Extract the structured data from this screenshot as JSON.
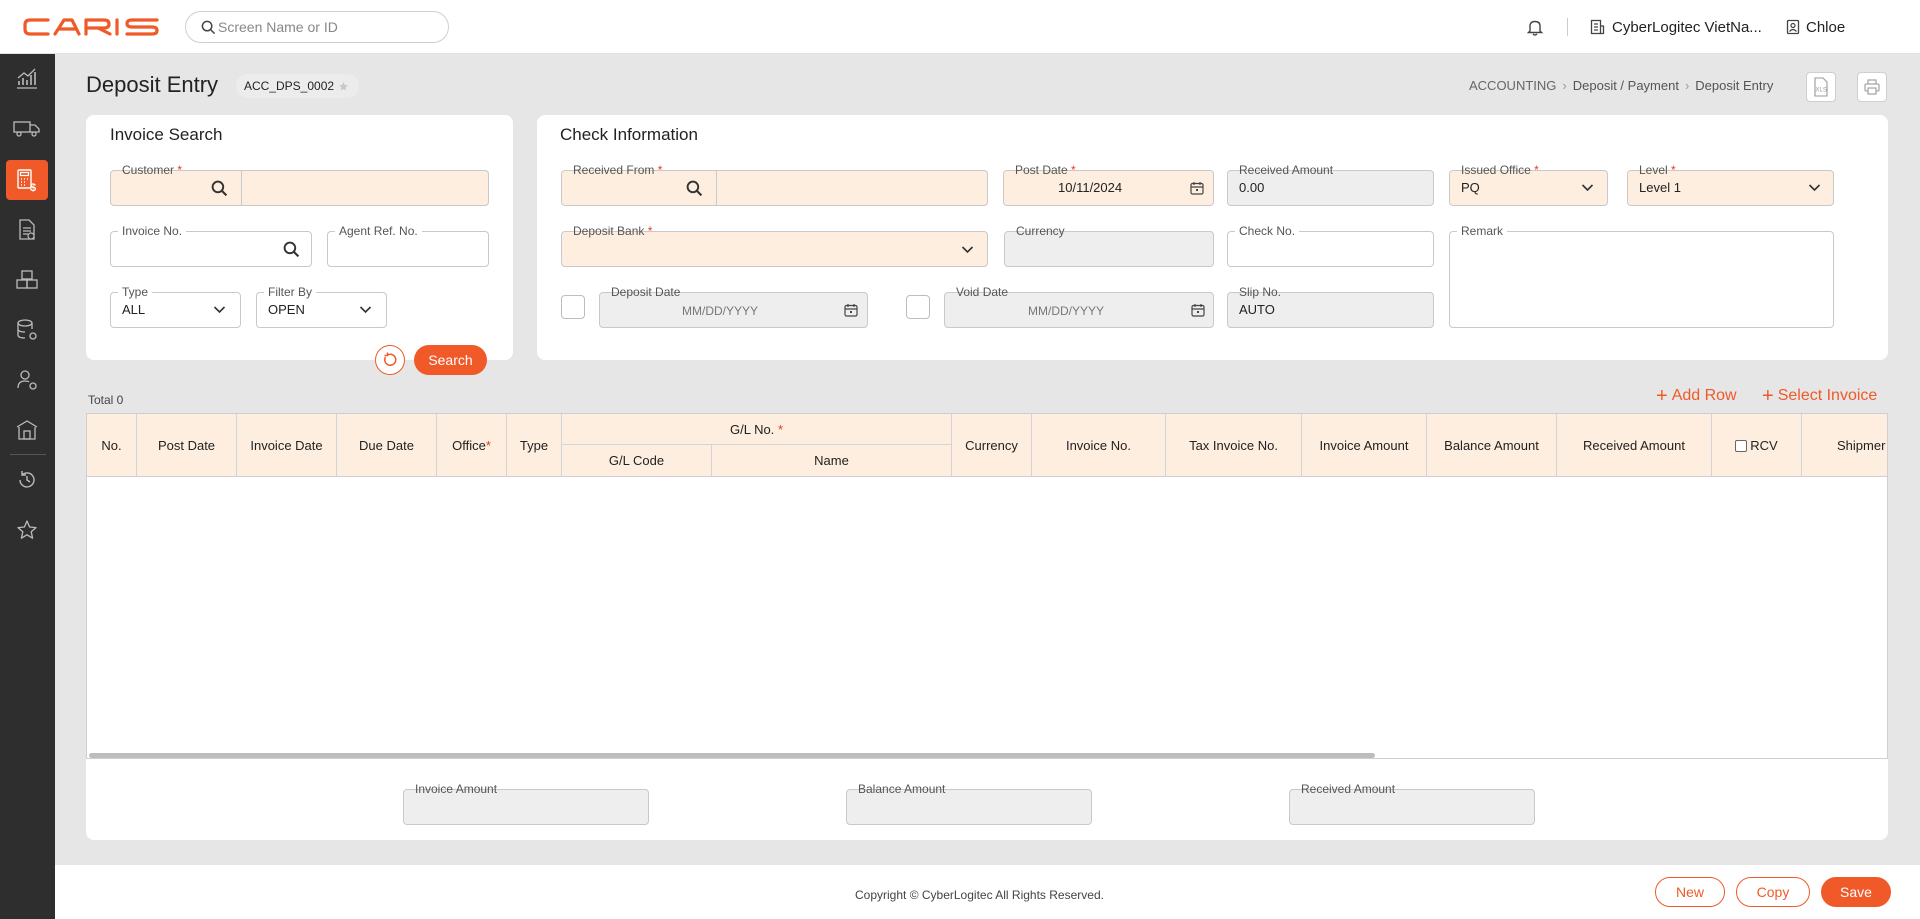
{
  "header": {
    "logo_text": "CARIS",
    "search_placeholder": "Screen Name or ID",
    "company": "CyberLogitec VietNa...",
    "user": "Chloe"
  },
  "sidebar": {
    "items": [
      {
        "icon": "dashboard-chart-icon",
        "active": false
      },
      {
        "icon": "truck-icon",
        "active": false
      },
      {
        "icon": "calculator-icon",
        "active": true
      },
      {
        "icon": "document-icon",
        "active": false
      },
      {
        "icon": "boxes-icon",
        "active": false
      },
      {
        "icon": "database-settings-icon",
        "active": false
      },
      {
        "icon": "user-settings-icon",
        "active": false
      },
      {
        "icon": "building-icon",
        "active": false
      },
      {
        "icon": "history-icon",
        "active": false
      },
      {
        "icon": "star-icon",
        "active": false
      }
    ]
  },
  "page": {
    "title": "Deposit Entry",
    "screen_id": "ACC_DPS_0002",
    "breadcrumb": [
      "ACCOUNTING",
      "Deposit / Payment",
      "Deposit Entry"
    ]
  },
  "invoice_search": {
    "title": "Invoice Search",
    "customer_label": "Customer",
    "invoice_no_label": "Invoice No.",
    "agent_ref_label": "Agent Ref. No.",
    "type_label": "Type",
    "type_value": "ALL",
    "filter_label": "Filter By",
    "filter_value": "OPEN",
    "search_button": "Search"
  },
  "check_info": {
    "title": "Check Information",
    "received_from_label": "Received From",
    "post_date_label": "Post Date",
    "post_date_value": "10/11/2024",
    "received_amount_label": "Received Amount",
    "received_amount_value": "0.00",
    "issued_office_label": "Issued Office",
    "issued_office_value": "PQ",
    "level_label": "Level",
    "level_value": "Level 1",
    "deposit_bank_label": "Deposit Bank",
    "currency_label": "Currency",
    "check_no_label": "Check No.",
    "remark_label": "Remark",
    "deposit_date_label": "Deposit Date",
    "deposit_date_placeholder": "MM/DD/YYYY",
    "void_date_label": "Void Date",
    "void_date_placeholder": "MM/DD/YYYY",
    "slip_no_label": "Slip No.",
    "slip_no_value": "AUTO"
  },
  "grid": {
    "total": "Total 0",
    "add_row": "Add Row",
    "select_invoice": "Select Invoice",
    "columns": {
      "no": "No.",
      "post_date": "Post Date",
      "invoice_date": "Invoice Date",
      "due_date": "Due Date",
      "office": "Office",
      "type": "Type",
      "gl_no": "G/L No.",
      "gl_code": "G/L Code",
      "gl_name": "Name",
      "currency": "Currency",
      "invoice_no": "Invoice No.",
      "tax_invoice_no": "Tax Invoice No.",
      "invoice_amount": "Invoice Amount",
      "balance_amount": "Balance Amount",
      "received_amount": "Received Amount",
      "rcv": "RCV",
      "shipment": "Shipmer"
    },
    "rows": []
  },
  "totals": {
    "invoice_amount_label": "Invoice Amount",
    "balance_amount_label": "Balance Amount",
    "received_amount_label": "Received Amount"
  },
  "footer": {
    "copyright": "Copyright © CyberLogitec All Rights Reserved.",
    "new_button": "New",
    "copy_button": "Copy",
    "save_button": "Save"
  },
  "colors": {
    "accent": "#f05a28",
    "required_bg": "#fdeedf",
    "sidebar_bg": "#2e2e2e"
  }
}
